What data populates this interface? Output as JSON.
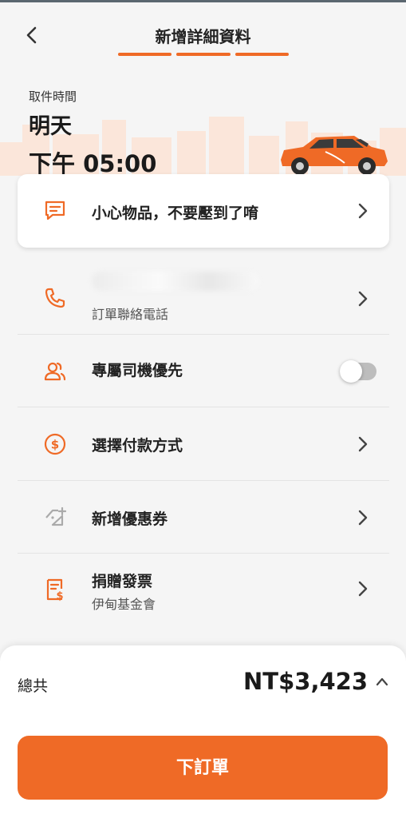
{
  "header": {
    "title": "新增詳細資料",
    "back_icon": "chevron-left-icon",
    "progress_steps": 3,
    "progress_active": 3
  },
  "pickup": {
    "label": "取件時間",
    "day": "明天",
    "time": "下午 05:00"
  },
  "note": {
    "icon": "message-icon",
    "text": "小心物品，不要壓到了唷"
  },
  "rows": {
    "contact": {
      "icon": "phone-icon",
      "value_redacted": true,
      "sub": "訂單聯絡電話"
    },
    "exclusive_driver": {
      "icon": "users-icon",
      "label": "專屬司機優先",
      "enabled": false
    },
    "payment": {
      "icon": "dollar-icon",
      "label": "選擇付款方式"
    },
    "coupon": {
      "icon": "tag-plus-icon",
      "label": "新增優惠券"
    },
    "invoice": {
      "icon": "receipt-icon",
      "label": "捐贈發票",
      "sub": "伊甸基金會"
    }
  },
  "summary": {
    "total_label": "總共",
    "total_value": "NT$3,423"
  },
  "actions": {
    "order_label": "下訂單"
  },
  "colors": {
    "accent": "#ef6a26",
    "background": "#f5f5f5",
    "toggle_off": "#bdbdbd"
  }
}
